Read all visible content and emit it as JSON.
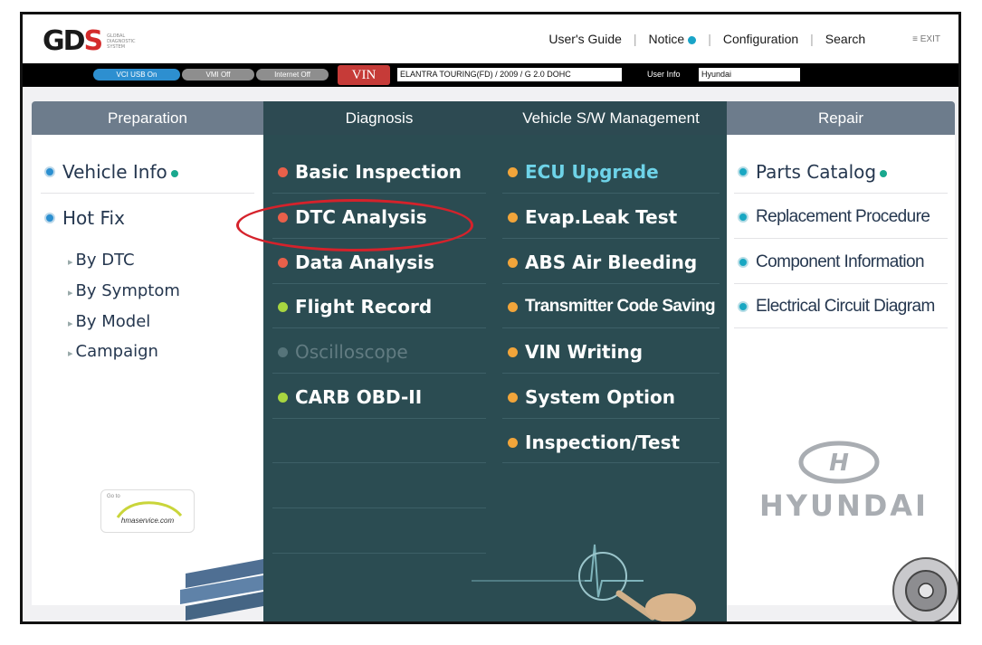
{
  "header": {
    "logo": "GDS",
    "logo_subtitle": "GLOBAL DIAGNOSTIC SYSTEM",
    "nav": [
      "User's Guide",
      "Notice",
      "Configuration",
      "Search"
    ],
    "exit": "EXIT"
  },
  "status": {
    "vci": "VCI USB On",
    "vmi": "VMI Off",
    "internet": "Internet Off",
    "vin_button": "VIN",
    "vin_value": "ELANTRA TOURING(FD) / 2009 / G 2.0 DOHC",
    "user_label": "User Info",
    "user_value": "Hyundai"
  },
  "menu": {
    "tabs": [
      "Preparation",
      "Diagnosis",
      "Vehicle S/W Management",
      "Repair"
    ],
    "preparation": {
      "vehicle_info": "Vehicle Info",
      "hot_fix": "Hot Fix",
      "sub_items": [
        "By DTC",
        "By Symptom",
        "By Model",
        "Campaign"
      ]
    },
    "diagnosis": [
      {
        "label": "Basic Inspection",
        "dot": "#e9604a"
      },
      {
        "label": "DTC Analysis",
        "dot": "#e9604a"
      },
      {
        "label": "Data Analysis",
        "dot": "#e9604a"
      },
      {
        "label": "Flight Record",
        "dot": "#a8d640"
      },
      {
        "label": "Oscilloscope",
        "dot": "#56747a"
      },
      {
        "label": "CARB OBD-II",
        "dot": "#a8d640"
      }
    ],
    "vehicle_sw": [
      {
        "label": "ECU Upgrade",
        "dot": "#f2a53a"
      },
      {
        "label": "Evap.Leak Test",
        "dot": "#f2a53a"
      },
      {
        "label": "ABS Air Bleeding",
        "dot": "#f2a53a"
      },
      {
        "label": "Transmitter Code Saving",
        "dot": "#f2a53a"
      },
      {
        "label": "VIN Writing",
        "dot": "#f2a53a"
      },
      {
        "label": "System Option",
        "dot": "#f2a53a"
      },
      {
        "label": "Inspection/Test",
        "dot": "#f2a53a"
      }
    ],
    "repair": [
      "Parts Catalog",
      "Replacement Procedure",
      "Component Information",
      "Electrical Circuit Diagram"
    ]
  },
  "branding": {
    "hyundai": "HYUNDAI",
    "hmaservice_goto": "Go to",
    "hmaservice_url": "hmaservice.com"
  }
}
